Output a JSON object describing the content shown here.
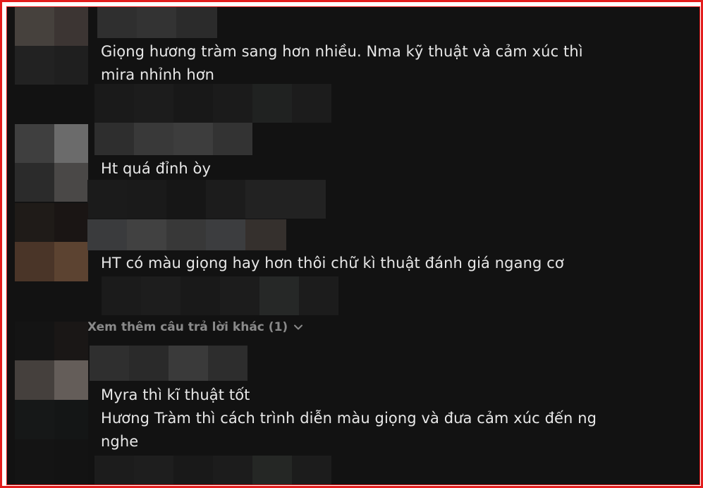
{
  "comments": [
    {
      "lines": [
        "Giọng hương tràm sang hơn nhiều. Nma kỹ thuật và cảm xúc thì",
        "mira nhỉnh hơn"
      ]
    },
    {
      "lines": [
        "Ht quá đỉnh òy"
      ]
    },
    {
      "lines": [
        "HT có màu giọng hay hơn thôi chữ kì thuật đánh giá ngang cơ"
      ]
    },
    {
      "lines": [
        "Myra thì kĩ thuật tốt",
        "Hương Tràm thì cách trình diễn màu giọng và đưa cảm xúc đến ng",
        "nghe"
      ]
    }
  ],
  "see_more": {
    "label": "Xem thêm câu trả lời khác (1)",
    "icon": "chevron-down-icon"
  },
  "colors": {
    "background": "#121212",
    "border": "#e31c1c",
    "text": "#e8e8e8",
    "muted": "#8a8a8a"
  }
}
